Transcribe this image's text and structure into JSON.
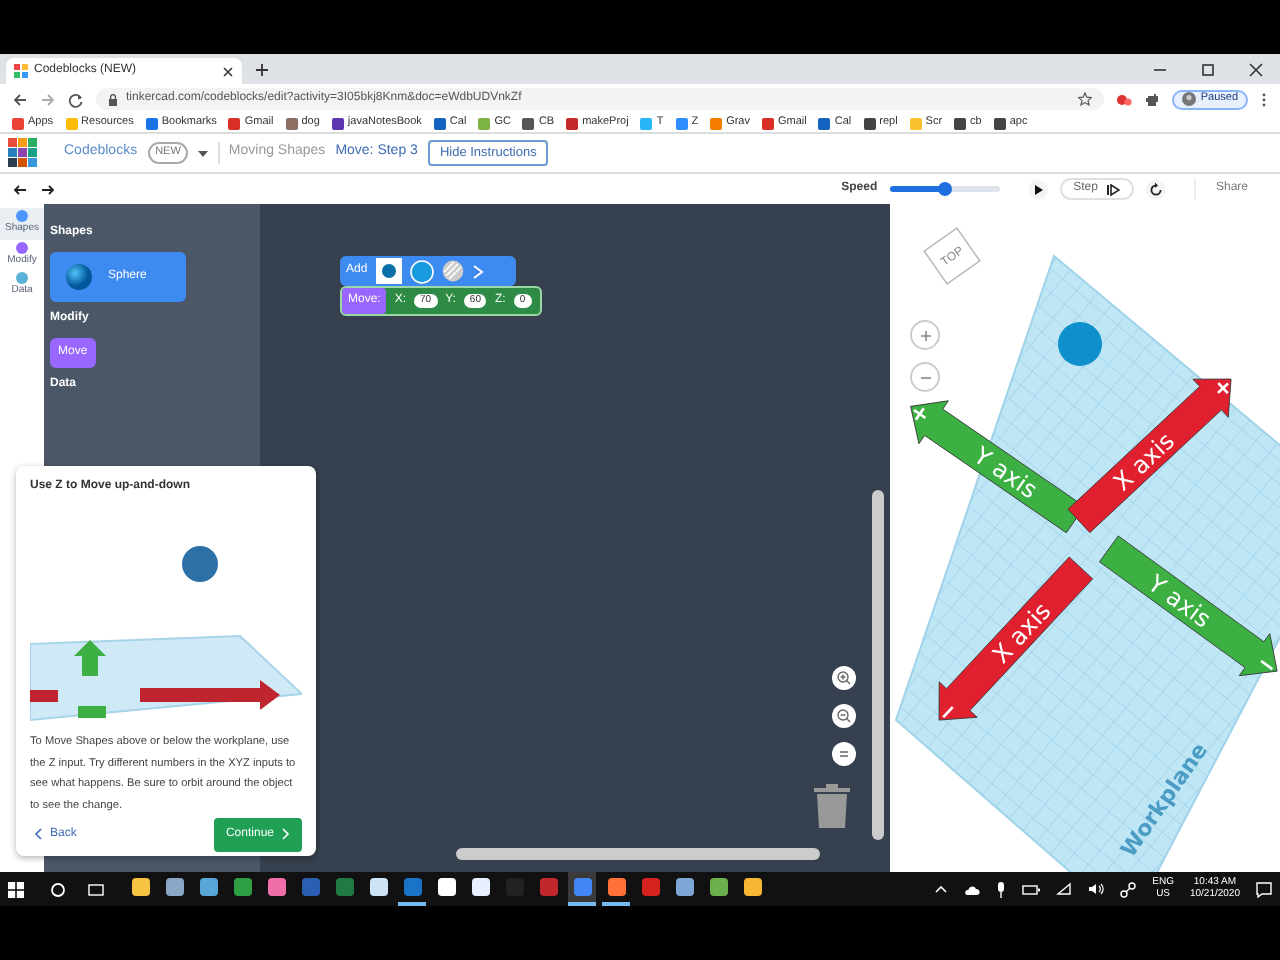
{
  "browser": {
    "tab_title": "Codeblocks (NEW)",
    "url": "tinkercad.com/codeblocks/edit?activity=3I05bkj8Knm&doc=eWdbUDVnkZf",
    "profile": "Paused",
    "bookmarks": [
      {
        "label": "Apps"
      },
      {
        "label": "Resources"
      },
      {
        "label": "Bookmarks"
      },
      {
        "label": "Gmail"
      },
      {
        "label": "dog"
      },
      {
        "label": "javaNotesBook"
      },
      {
        "label": "Cal"
      },
      {
        "label": "GC"
      },
      {
        "label": "CB"
      },
      {
        "label": "makeProj"
      },
      {
        "label": "T"
      },
      {
        "label": "Z"
      },
      {
        "label": "Grav"
      },
      {
        "label": "Gmail"
      },
      {
        "label": "Cal"
      },
      {
        "label": "repl"
      },
      {
        "label": "Scr"
      },
      {
        "label": "cb"
      },
      {
        "label": "apc"
      }
    ]
  },
  "header": {
    "app": "Codeblocks",
    "badge": "NEW",
    "lesson": "Moving Shapes",
    "step": "Move: Step 3",
    "hide_button": "Hide Instructions"
  },
  "toolbar": {
    "speed_label": "Speed",
    "speed": {
      "level": 0.5
    },
    "step_button": "Step",
    "share_button": "Share"
  },
  "categories": [
    {
      "label": "Shapes",
      "color": "#4c97ff",
      "selected": true
    },
    {
      "label": "Modify",
      "color": "#9966ff",
      "selected": false
    },
    {
      "label": "Data",
      "color": "#5cb1d6",
      "selected": false
    }
  ],
  "palette": {
    "sections": [
      {
        "heading": "Shapes",
        "blocks": [
          {
            "kind": "shape",
            "label": "Sphere"
          }
        ]
      },
      {
        "heading": "Modify",
        "blocks": [
          {
            "kind": "modify",
            "label": "Move"
          }
        ]
      },
      {
        "heading": "Data"
      }
    ]
  },
  "workspace": {
    "add_block": {
      "label": "Add"
    },
    "move_block": {
      "label": "Move:",
      "inputs": [
        {
          "axis": "X:",
          "value": "70"
        },
        {
          "axis": "Y:",
          "value": "60"
        },
        {
          "axis": "Z:",
          "value": "0"
        }
      ]
    }
  },
  "instructions": {
    "title": "Use Z to Move up-and-down",
    "body": "To Move Shapes above or below the workplane, use the Z input. Try different numbers in the XYZ inputs to see what happens. Be sure to orbit around the object to see the change.",
    "back": "Back",
    "continue": "Continue"
  },
  "viewport": {
    "view_cube": "TOP",
    "plane_label": "Workplane",
    "axes": [
      {
        "label": "Y axis",
        "sign": "+",
        "color": "#3cb043"
      },
      {
        "label": "X axis",
        "sign": "+",
        "color": "#e0202e"
      },
      {
        "label": "X axis",
        "sign": "−",
        "color": "#e0202e"
      },
      {
        "label": "Y axis",
        "sign": "−",
        "color": "#3cb043"
      }
    ]
  },
  "taskbar": {
    "apps": [
      {
        "running": false,
        "selected": false
      },
      {
        "running": false,
        "selected": false
      },
      {
        "running": false,
        "selected": false
      },
      {
        "running": false,
        "selected": false
      },
      {
        "running": false,
        "selected": false
      },
      {
        "running": false,
        "selected": false
      },
      {
        "running": false,
        "selected": false
      },
      {
        "running": false,
        "selected": false
      },
      {
        "running": true,
        "selected": false
      },
      {
        "running": false,
        "selected": false
      },
      {
        "running": false,
        "selected": false
      },
      {
        "running": false,
        "selected": false
      },
      {
        "running": false,
        "selected": false
      },
      {
        "running": true,
        "selected": true
      },
      {
        "running": true,
        "selected": false
      },
      {
        "running": false,
        "selected": false
      },
      {
        "running": false,
        "selected": false
      },
      {
        "running": false,
        "selected": false
      },
      {
        "running": false,
        "selected": false
      }
    ],
    "language": "ENG",
    "region": "US",
    "time": "10:43 AM",
    "date": "10/21/2020"
  }
}
